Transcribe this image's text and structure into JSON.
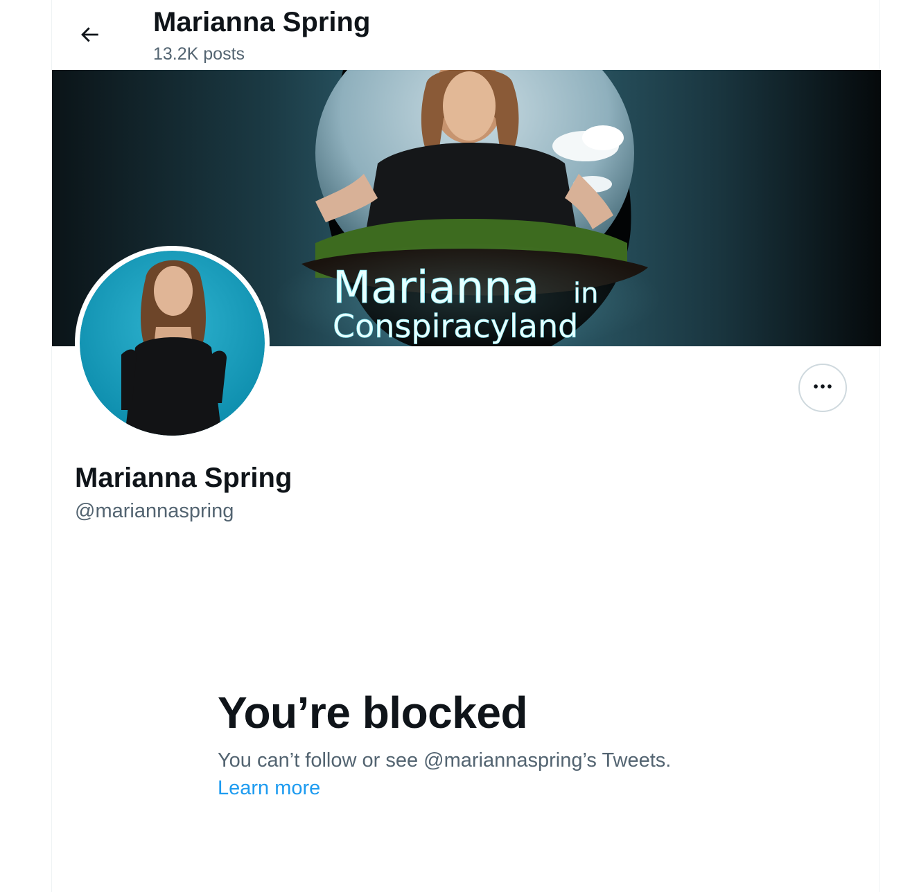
{
  "header": {
    "back_icon": "arrow-left-icon",
    "title": "Marianna Spring",
    "posts_count": "13.2K posts"
  },
  "banner": {
    "title_line1": "Marianna",
    "title_line1_small": "in",
    "title_line2": "Conspiracyland"
  },
  "profile": {
    "name": "Marianna Spring",
    "handle": "@mariannaspring",
    "more_icon": "more-horizontal-icon"
  },
  "blocked": {
    "title": "You’re blocked",
    "description": "You can’t follow or see @mariannaspring’s Tweets.",
    "learn_more": "Learn more"
  },
  "colors": {
    "text_primary": "#0f1419",
    "text_secondary": "#536471",
    "link": "#1d9bf0",
    "border": "#cfd9de"
  }
}
